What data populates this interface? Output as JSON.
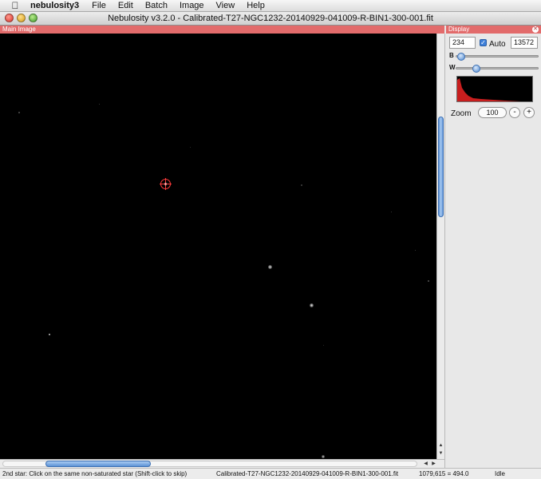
{
  "menubar": {
    "apple_icon": "apple-logo-icon",
    "app_name": "nebulosity3",
    "items": [
      "File",
      "Edit",
      "Batch",
      "Image",
      "View",
      "Help"
    ]
  },
  "window": {
    "title": "Nebulosity v3.2.0 - Calibrated-T27-NGC1232-20140929-041009-R-BIN1-300-001.fit"
  },
  "main_panel": {
    "header": "Main Image"
  },
  "display_panel": {
    "header": "Display",
    "black_value": "234",
    "white_value": "13572",
    "auto_checked": true,
    "auto_label": "Auto",
    "b_label": "B",
    "w_label": "W",
    "b_slider_level": 0.02,
    "w_slider_level": 0.22,
    "zoom_label": "Zoom",
    "zoom_value": "100",
    "zoom_minus": "-",
    "zoom_plus": "+"
  },
  "scrollbars": {
    "vertical_scroll_fraction": 0.25,
    "horizontal_scroll_fraction": 0.11
  },
  "status": {
    "message": "2nd star: Click on the same non-saturated star (Shift-click to skip)",
    "filename": "Calibrated-T27-NGC1232-20140929-041009-R-BIN1-300-001.fit",
    "coords": "1079,615 = 494.0",
    "state": "Idle"
  },
  "colors": {
    "panel_header": "#e26b6b",
    "accent": "#5d93d6",
    "target_ring": "#ff3b3b",
    "histogram": "#c81e1e"
  }
}
